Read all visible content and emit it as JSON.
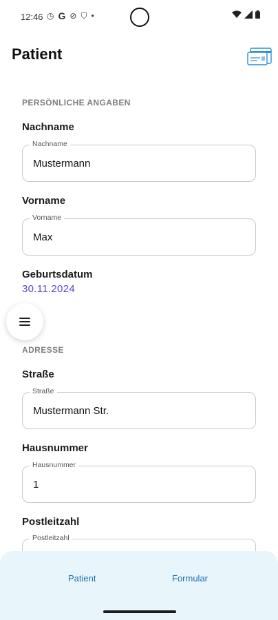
{
  "status_bar": {
    "time": "12:46",
    "icons": [
      "clock-icon",
      "google-icon",
      "shield-icon",
      "shield-lock-icon",
      "dot-icon"
    ],
    "right_icons": [
      "wifi-icon",
      "signal-icon",
      "battery-icon"
    ]
  },
  "header": {
    "title": "Patient",
    "action_icon": "insurance-card-icon"
  },
  "personal": {
    "section_title": "PERSÖNLICHE ANGABEN",
    "lastname": {
      "label": "Nachname",
      "legend": "Nachname",
      "value": "Mustermann"
    },
    "firstname": {
      "label": "Vorname",
      "legend": "Vorname",
      "value": "Max"
    },
    "birthdate": {
      "label": "Geburtsdatum",
      "value": "30.11.2024"
    }
  },
  "address": {
    "section_title": "ADRESSE",
    "street": {
      "label": "Straße",
      "legend": "Straße",
      "value": "Mustermann Str."
    },
    "housenumber": {
      "label": "Hausnummer",
      "legend": "Hausnummer",
      "value": "1"
    },
    "postcode": {
      "label": "Postleitzahl",
      "legend": "Postleitzahl",
      "value": ""
    }
  },
  "bottom_nav": {
    "tabs": [
      {
        "label": "Patient"
      },
      {
        "label": "Formular"
      }
    ]
  },
  "colors": {
    "accent_date": "#5548d9",
    "nav_text": "#1c6fae",
    "nav_background": "#e8f6fb"
  }
}
